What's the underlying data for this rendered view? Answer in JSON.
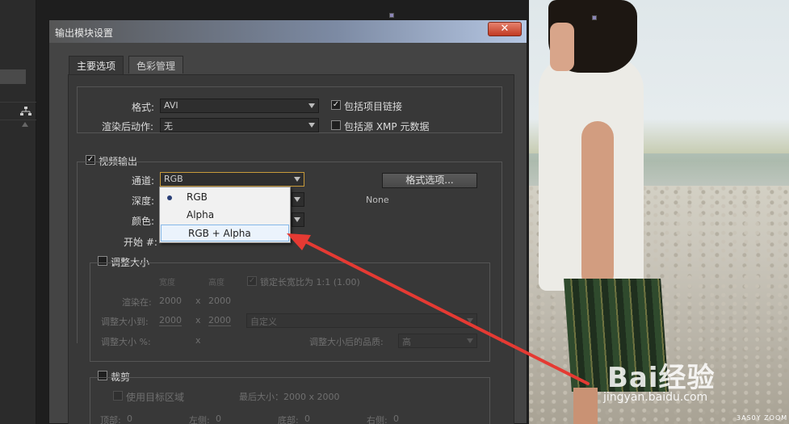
{
  "dialog": {
    "title": "输出模块设置",
    "close_label": "✕",
    "tabs": [
      "主要选项",
      "色彩管理"
    ]
  },
  "main": {
    "format_label": "格式:",
    "format_value": "AVI",
    "post_render_label": "渲染后动作:",
    "post_render_value": "无",
    "include_project_link": "包括项目链接",
    "include_project_link_checked": true,
    "include_xmp": "包括源 XMP 元数据",
    "include_xmp_checked": false
  },
  "video_output": {
    "label": "视频输出",
    "checked": true,
    "channels_label": "通道:",
    "channels_value": "RGB",
    "depth_label": "深度:",
    "color_label": "颜色:",
    "start_label": "开始 #:",
    "format_options_button": "格式选项...",
    "codec_value": "None",
    "channel_options": [
      {
        "label": "RGB",
        "selected": true
      },
      {
        "label": "Alpha",
        "selected": false
      },
      {
        "label": "RGB + Alpha",
        "selected": false,
        "highlighted": true
      }
    ]
  },
  "resize": {
    "label": "调整大小",
    "checked": false,
    "width_header": "宽度",
    "height_header": "高度",
    "lock_aspect": "锁定长宽比为 1:1 (1.00)",
    "render_at_label": "渲染在:",
    "render_w": "2000",
    "render_h": "2000",
    "resize_to_label": "调整大小到:",
    "resize_w": "2000",
    "resize_h": "2000",
    "preset_value": "自定义",
    "resize_pct_label": "调整大小 %:",
    "times": "x",
    "quality_label": "调整大小后的品质:",
    "quality_value": "高"
  },
  "crop": {
    "label": "裁剪",
    "checked": false,
    "use_roi": "使用目标区域",
    "final_size": "最后大小：2000 x 2000",
    "top_label": "顶部:",
    "top_value": "0",
    "left_label": "左侧:",
    "left_value": "0",
    "bottom_label": "底部:",
    "bottom_value": "0",
    "right_label": "右侧:",
    "right_value": "0"
  },
  "watermark": {
    "brand": "Bai经验",
    "url": "jingyan.baidu.com"
  },
  "photo_credit": "3AS0Y ZOOM",
  "icons": {
    "network": "network-icon",
    "arrow": "red-annotation-arrow"
  },
  "colors": {
    "arrow": "#e53a33",
    "dialog_bg": "#444444",
    "panel_bg": "#383838",
    "titlebar_end": "#b6c7e3"
  }
}
